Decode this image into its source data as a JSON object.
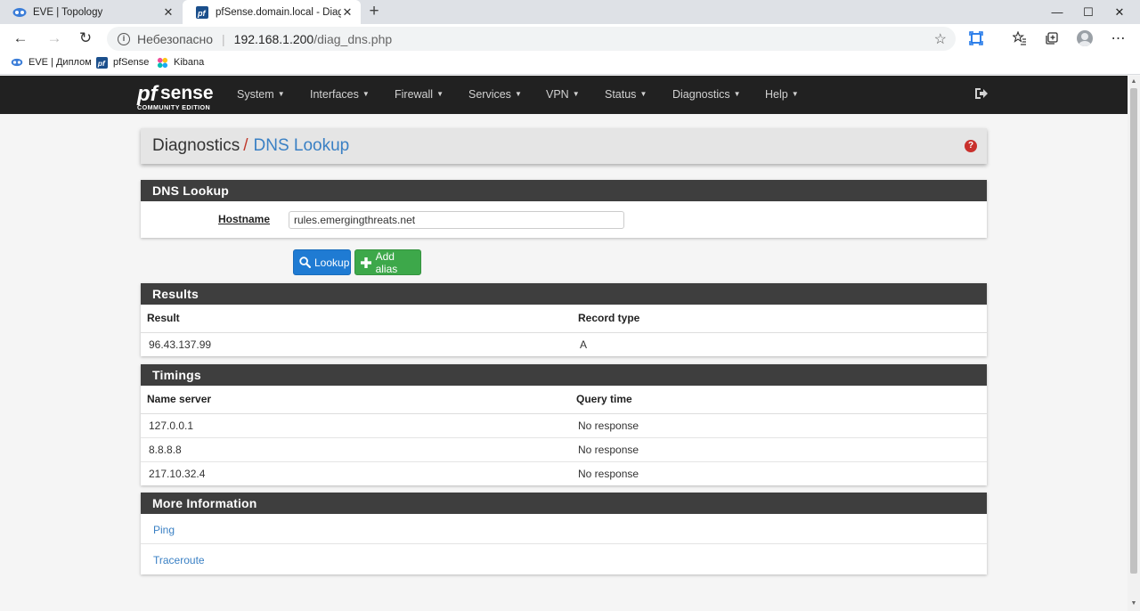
{
  "browser": {
    "tabs": [
      {
        "title": "EVE | Topology",
        "active": false
      },
      {
        "title": "pfSense.domain.local - Diagnostics: DNS Lookup",
        "active": true
      }
    ],
    "new_tab": "+",
    "window_controls": {
      "minimize": "—",
      "maximize": "☐",
      "close": "✕"
    },
    "nav": {
      "back": "←",
      "forward": "→",
      "reload": "↻"
    },
    "address": {
      "security_label": "Небезопасно",
      "separator": "|",
      "host": "192.168.1.200",
      "path": "/diag_dns.php"
    },
    "bookmarks": [
      {
        "label": "EVE | Диплом",
        "icon": "eve-icon"
      },
      {
        "label": "pfSense",
        "icon": "pfsense-icon"
      },
      {
        "label": "Kibana",
        "icon": "kibana-icon"
      }
    ]
  },
  "pfsense": {
    "logo_text": "sense",
    "logo_subtitle": "COMMUNITY EDITION",
    "menu": [
      {
        "label": "System"
      },
      {
        "label": "Interfaces"
      },
      {
        "label": "Firewall"
      },
      {
        "label": "Services"
      },
      {
        "label": "VPN"
      },
      {
        "label": "Status"
      },
      {
        "label": "Diagnostics"
      },
      {
        "label": "Help"
      }
    ],
    "breadcrumb": {
      "root": "Diagnostics",
      "separator": "/",
      "leaf": "DNS Lookup"
    },
    "help_icon": "?"
  },
  "dns_lookup": {
    "heading": "DNS Lookup",
    "hostname_label": "Hostname",
    "hostname_value": "rules.emergingthreats.net",
    "lookup_button": "Lookup",
    "add_alias_button": "Add alias"
  },
  "results": {
    "heading": "Results",
    "columns": [
      "Result",
      "Record type"
    ],
    "rows": [
      [
        "96.43.137.99",
        "A"
      ]
    ]
  },
  "timings": {
    "heading": "Timings",
    "columns": [
      "Name server",
      "Query time"
    ],
    "rows": [
      [
        "127.0.0.1",
        "No response"
      ],
      [
        "8.8.8.8",
        "No response"
      ],
      [
        "217.10.32.4",
        "No response"
      ]
    ]
  },
  "more_info": {
    "heading": "More Information",
    "links": [
      "Ping",
      "Traceroute"
    ]
  },
  "colors": {
    "nav_bg": "#212121",
    "panel_heading_bg": "#3e3e3e",
    "link": "#3a80c4",
    "breadcrumb_sep": "#c0392b",
    "btn_primary": "#1f7bd3",
    "btn_success": "#3da84a"
  }
}
